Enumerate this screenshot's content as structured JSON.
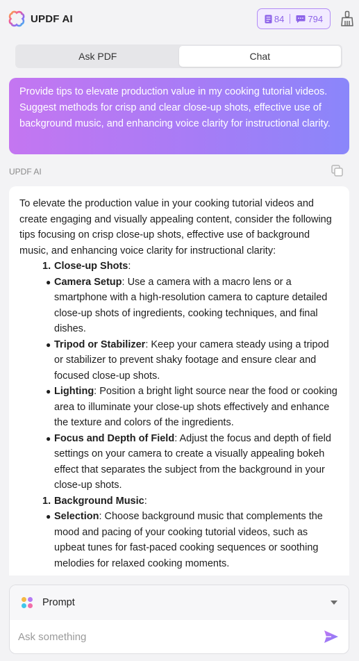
{
  "header": {
    "title": "UPDF AI",
    "quota_pdf": "84",
    "quota_chat": "794",
    "accent": "#8c62e8"
  },
  "tabs": [
    {
      "label": "Ask PDF",
      "active": false
    },
    {
      "label": "Chat",
      "active": true
    }
  ],
  "user_prompt": "Provide tips to elevate production value in my cooking tutorial videos. Suggest methods for crisp and clear close-up shots, effective use of background music, and enhancing voice clarity for instructional clarity.",
  "ai_label": "UPDF AI",
  "answer": {
    "intro": "To elevate the production value in your cooking tutorial videos and create engaging and visually appealing content, consider the following tips focusing on crisp close-up shots, effective use of background music, and enhancing voice clarity for instructional clarity:",
    "sections": [
      {
        "num": "1.",
        "title": "Close-up Shots",
        "bullets": [
          {
            "term": "Camera Setup",
            "text": ": Use a camera with a macro lens or a smartphone with a high-resolution camera to capture detailed close-up shots of ingredients, cooking techniques, and final dishes."
          },
          {
            "term": "Tripod or Stabilizer",
            "text": ": Keep your camera steady using a tripod or stabilizer to prevent shaky footage and ensure clear and focused close-up shots."
          },
          {
            "term": "Lighting",
            "text": ": Position a bright light source near the food or cooking area to illuminate your close-up shots effectively and enhance the texture and colors of the ingredients."
          },
          {
            "term": "Focus and Depth of Field",
            "text": ": Adjust the focus and depth of field settings on your camera to create a visually appealing bokeh effect that separates the subject from the background in your close-up shots."
          }
        ]
      },
      {
        "num": "1.",
        "title": "Background Music",
        "bullets": [
          {
            "term": "Selection",
            "text": ": Choose background music that complements the mood and pacing of your cooking tutorial videos, such as upbeat tunes for fast-paced cooking sequences or soothing melodies for relaxed cooking moments."
          }
        ]
      }
    ]
  },
  "composer": {
    "prompt_label": "Prompt",
    "placeholder": "Ask something"
  }
}
